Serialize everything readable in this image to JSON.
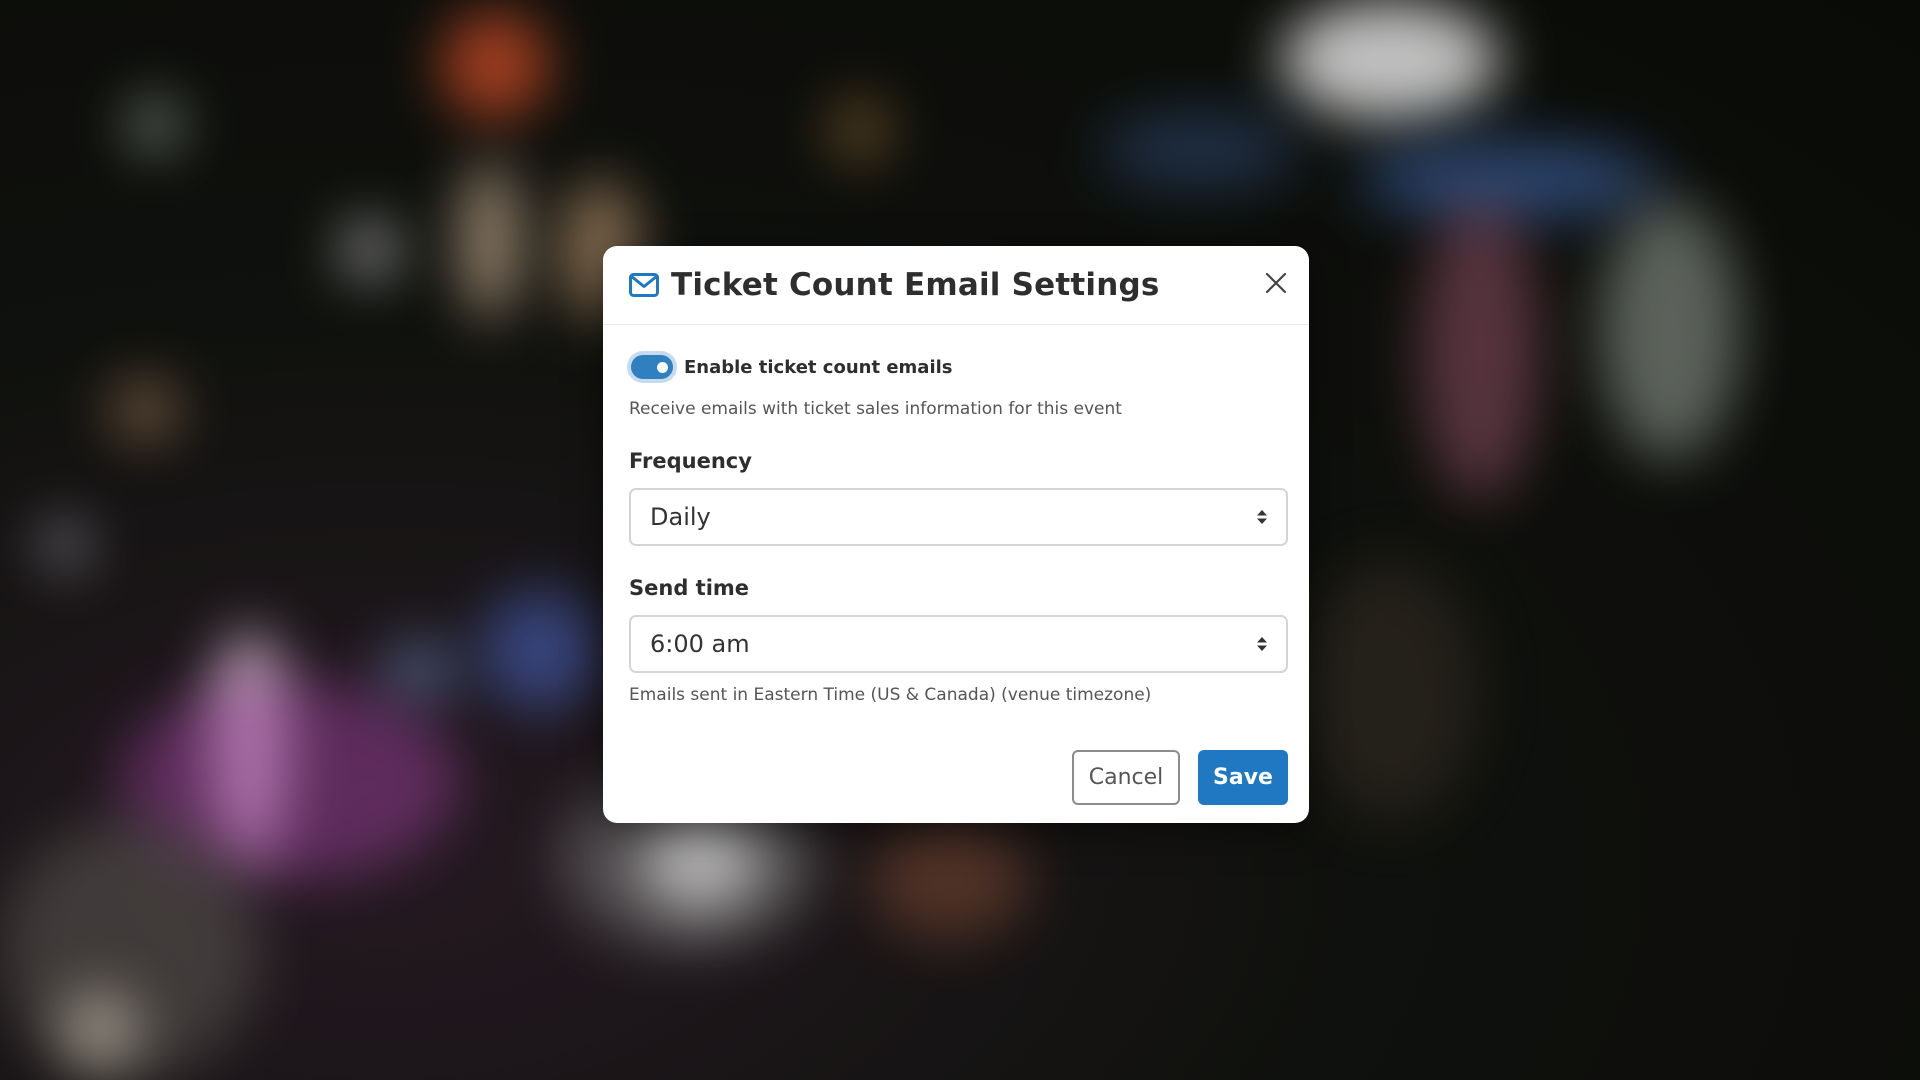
{
  "colors": {
    "accent": "#1f78c1",
    "toggle_on": "#2f7fc1",
    "modal_background": "#ffffff"
  },
  "modal": {
    "icon": "mail-icon",
    "title": "Ticket Count Email Settings",
    "close_icon": "close-icon"
  },
  "toggle": {
    "enabled": true,
    "label": "Enable ticket count emails",
    "help": "Receive emails with ticket sales information for this event"
  },
  "frequency": {
    "label": "Frequency",
    "value": "Daily"
  },
  "send_time": {
    "label": "Send time",
    "value": "6:00 am",
    "help": "Emails sent in Eastern Time (US & Canada) (venue timezone)"
  },
  "buttons": {
    "cancel": "Cancel",
    "save": "Save"
  }
}
